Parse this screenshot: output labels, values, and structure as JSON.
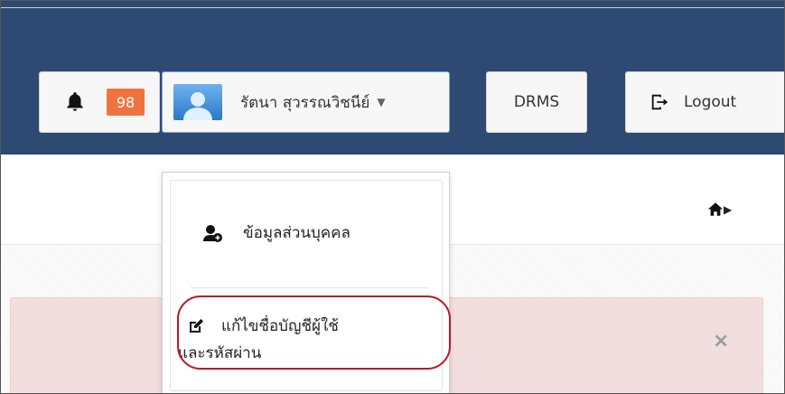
{
  "header": {
    "notification_count": "98",
    "user_name": "รัตนา สุวรรณวิชนีย์",
    "drms_label": "DRMS",
    "logout_label": "Logout"
  },
  "dropdown": {
    "items": [
      {
        "label": "ข้อมูลส่วนบุคคล",
        "icon": "user-add-icon"
      },
      {
        "label_line1": "แก้ไขชื่อบัญชีผู้ใช้",
        "label_line2": "และรหัสผ่าน",
        "icon": "edit-icon"
      }
    ]
  },
  "alert": {
    "close_glyph": "×"
  },
  "colors": {
    "topbar": "#2e4a72",
    "badge": "#f0733f",
    "alert_bg": "#f2dede",
    "highlight": "#b8182a"
  }
}
